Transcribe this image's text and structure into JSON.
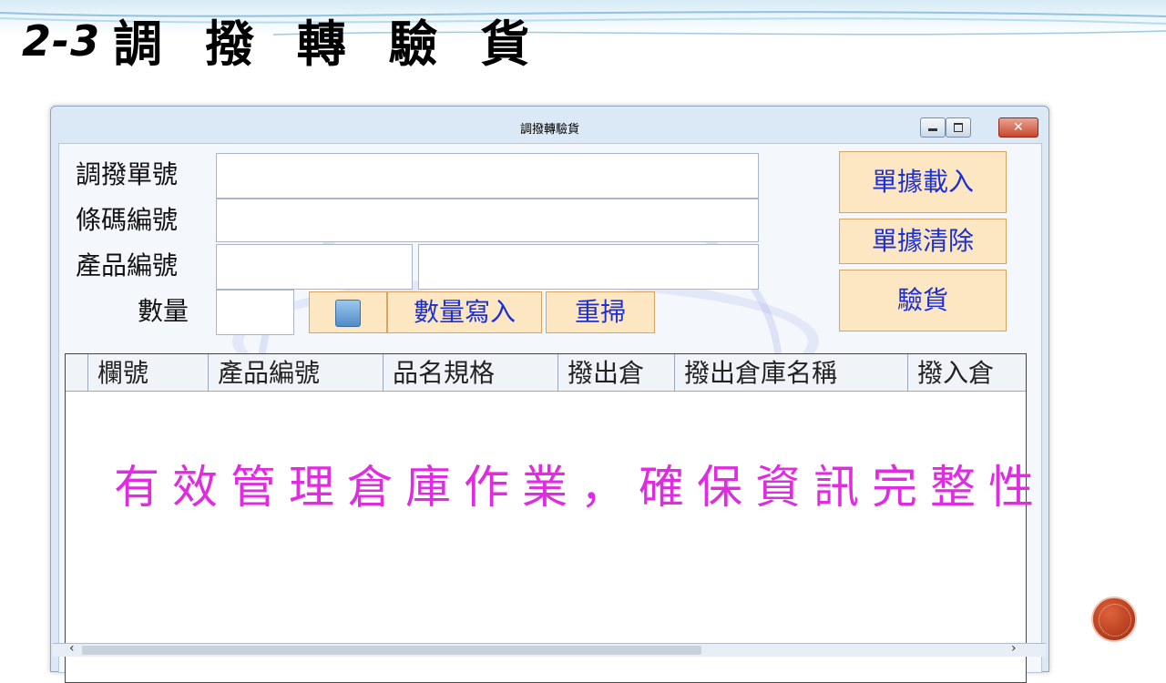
{
  "slide": {
    "number": "2-3",
    "title": "調 撥 轉 驗 貨"
  },
  "window": {
    "title": "調撥轉驗貨"
  },
  "form": {
    "transfer_no_label": "調撥單號",
    "transfer_no_value": "",
    "barcode_label": "條碼編號",
    "barcode_value": "",
    "product_no_label": "產品編號",
    "product_no_value": "",
    "product_name_value": "",
    "quantity_label": "數量",
    "quantity_value": ""
  },
  "buttons": {
    "load": "單據載入",
    "clear": "單據清除",
    "inspect": "驗貨",
    "write_qty": "數量寫入",
    "rescan": "重掃"
  },
  "grid": {
    "columns": [
      "欄號",
      "產品編號",
      "品名規格",
      "撥出倉",
      "撥出倉庫名稱",
      "撥入倉"
    ],
    "rows": []
  },
  "slogan": "有效管理倉庫作業，確保資訊完整性",
  "colors": {
    "button_bg": "#fde7c3",
    "button_text": "#1c2fd1",
    "slogan": "#e02ce0",
    "close_button": "#c8472e"
  },
  "icons": {
    "calculator": "calculator-icon",
    "nav": "next-slide-icon"
  }
}
